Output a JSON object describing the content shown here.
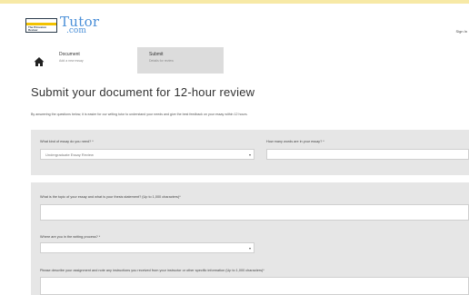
{
  "brand": {
    "box_text": "The Princeton Review",
    "name": "Tutor",
    "domain": ".com",
    "accent": "#4a8fd8",
    "stripe": "#f2c200"
  },
  "header": {
    "sign_in": "Sign In"
  },
  "stepper": {
    "home_icon": "home-icon",
    "steps": [
      {
        "title": "Document",
        "desc": "Add a new essay"
      },
      {
        "title": "Submit",
        "desc": "Details for review"
      }
    ]
  },
  "page": {
    "title": "Submit your document for 12-hour review",
    "intro": "By answering the questions below, it is easier for our writing tutor to understand your needs and give the best feedback on your essay within 12 hours."
  },
  "form": {
    "essay_type": {
      "label": "What kind of essay do you need? *",
      "value": "Undergraduate Essay Review"
    },
    "word_count": {
      "label": "How many words are in your essay? *",
      "value": ""
    },
    "main_idea": {
      "label": "What is the topic of your essay and what is your thesis statement? (Up to 1,000 characters)*",
      "value": ""
    },
    "writing_stage": {
      "label": "Where are you in the writing process? *",
      "value": ""
    },
    "feedback": {
      "label": "Please describe your assignment and note any instructions you received from your instructor or other specific information (Up to 1,000 characters)*",
      "value": ""
    }
  }
}
